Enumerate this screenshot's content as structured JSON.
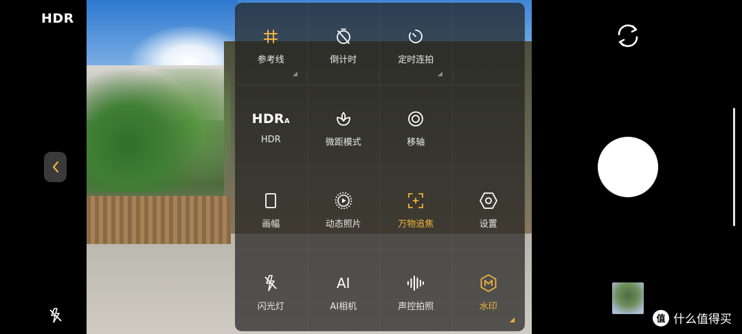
{
  "top_left": {
    "hdr_label": "HDR"
  },
  "settings_panel": {
    "items": [
      {
        "label": "参考线",
        "icon": "grid-hash-icon",
        "active": true,
        "has_submenu": true
      },
      {
        "label": "倒计时",
        "icon": "timer-off-icon",
        "active": false,
        "has_submenu": false
      },
      {
        "label": "定时连拍",
        "icon": "interval-timer-icon",
        "active": false,
        "has_submenu": true
      },
      {
        "label": "",
        "icon": "",
        "active": false,
        "has_submenu": false
      },
      {
        "label": "HDR",
        "icon": "hdr-auto-icon",
        "icon_text": "HDR",
        "icon_sub": "A",
        "active": false,
        "has_submenu": false
      },
      {
        "label": "微距模式",
        "icon": "macro-flower-icon",
        "active": false,
        "has_submenu": false
      },
      {
        "label": "移轴",
        "icon": "tilt-shift-icon",
        "active": false,
        "has_submenu": false
      },
      {
        "label": "",
        "icon": "",
        "active": false,
        "has_submenu": false
      },
      {
        "label": "画幅",
        "icon": "aspect-ratio-icon",
        "active": false,
        "has_submenu": false
      },
      {
        "label": "动态照片",
        "icon": "live-photo-icon",
        "active": false,
        "has_submenu": false
      },
      {
        "label": "万物追焦",
        "icon": "focus-track-icon",
        "active": true,
        "has_submenu": false
      },
      {
        "label": "设置",
        "icon": "settings-hexagon-icon",
        "active": false,
        "has_submenu": false
      },
      {
        "label": "闪光灯",
        "icon": "flash-off-icon",
        "active": false,
        "has_submenu": false
      },
      {
        "label": "AI相机",
        "icon": "ai-camera-icon",
        "icon_text": "AI",
        "active": false,
        "has_submenu": false
      },
      {
        "label": "声控拍照",
        "icon": "voice-wave-icon",
        "active": false,
        "has_submenu": false
      },
      {
        "label": "水印",
        "icon": "watermark-m-icon",
        "active": true,
        "has_submenu": true
      }
    ]
  },
  "watermark_brand": {
    "text": "什么值得买",
    "logo_char": "值"
  },
  "colors": {
    "accent": "#f2b43c",
    "panel_bg": "rgba(35,35,33,0.72)"
  }
}
